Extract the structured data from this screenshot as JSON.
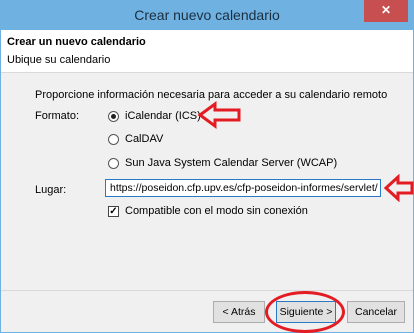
{
  "window": {
    "title": "Crear nuevo calendario",
    "close_symbol": "✕"
  },
  "header": {
    "title": "Crear un nuevo calendario",
    "subtitle": "Ubique su calendario"
  },
  "form": {
    "intro": "Proporcione información necesaria para acceder a su calendario remoto",
    "format_label": "Formato:",
    "format_options": [
      {
        "label": "iCalendar (ICS)",
        "selected": true
      },
      {
        "label": "CalDAV",
        "selected": false
      },
      {
        "label": "Sun Java System Calendar Server (WCAP)",
        "selected": false
      }
    ],
    "location_label": "Lugar:",
    "location_value": "https://poseidon.cfp.upv.es/cfp-poseidon-informes/servlet/",
    "offline_label": "Compatible con el modo sin conexión",
    "offline_checked": true,
    "check_mark": "✓"
  },
  "buttons": {
    "back": "< Atrás",
    "next": "Siguiente >",
    "cancel": "Cancelar"
  },
  "colors": {
    "annotation": "#e31b23",
    "titlebar": "#6fb1e1"
  }
}
